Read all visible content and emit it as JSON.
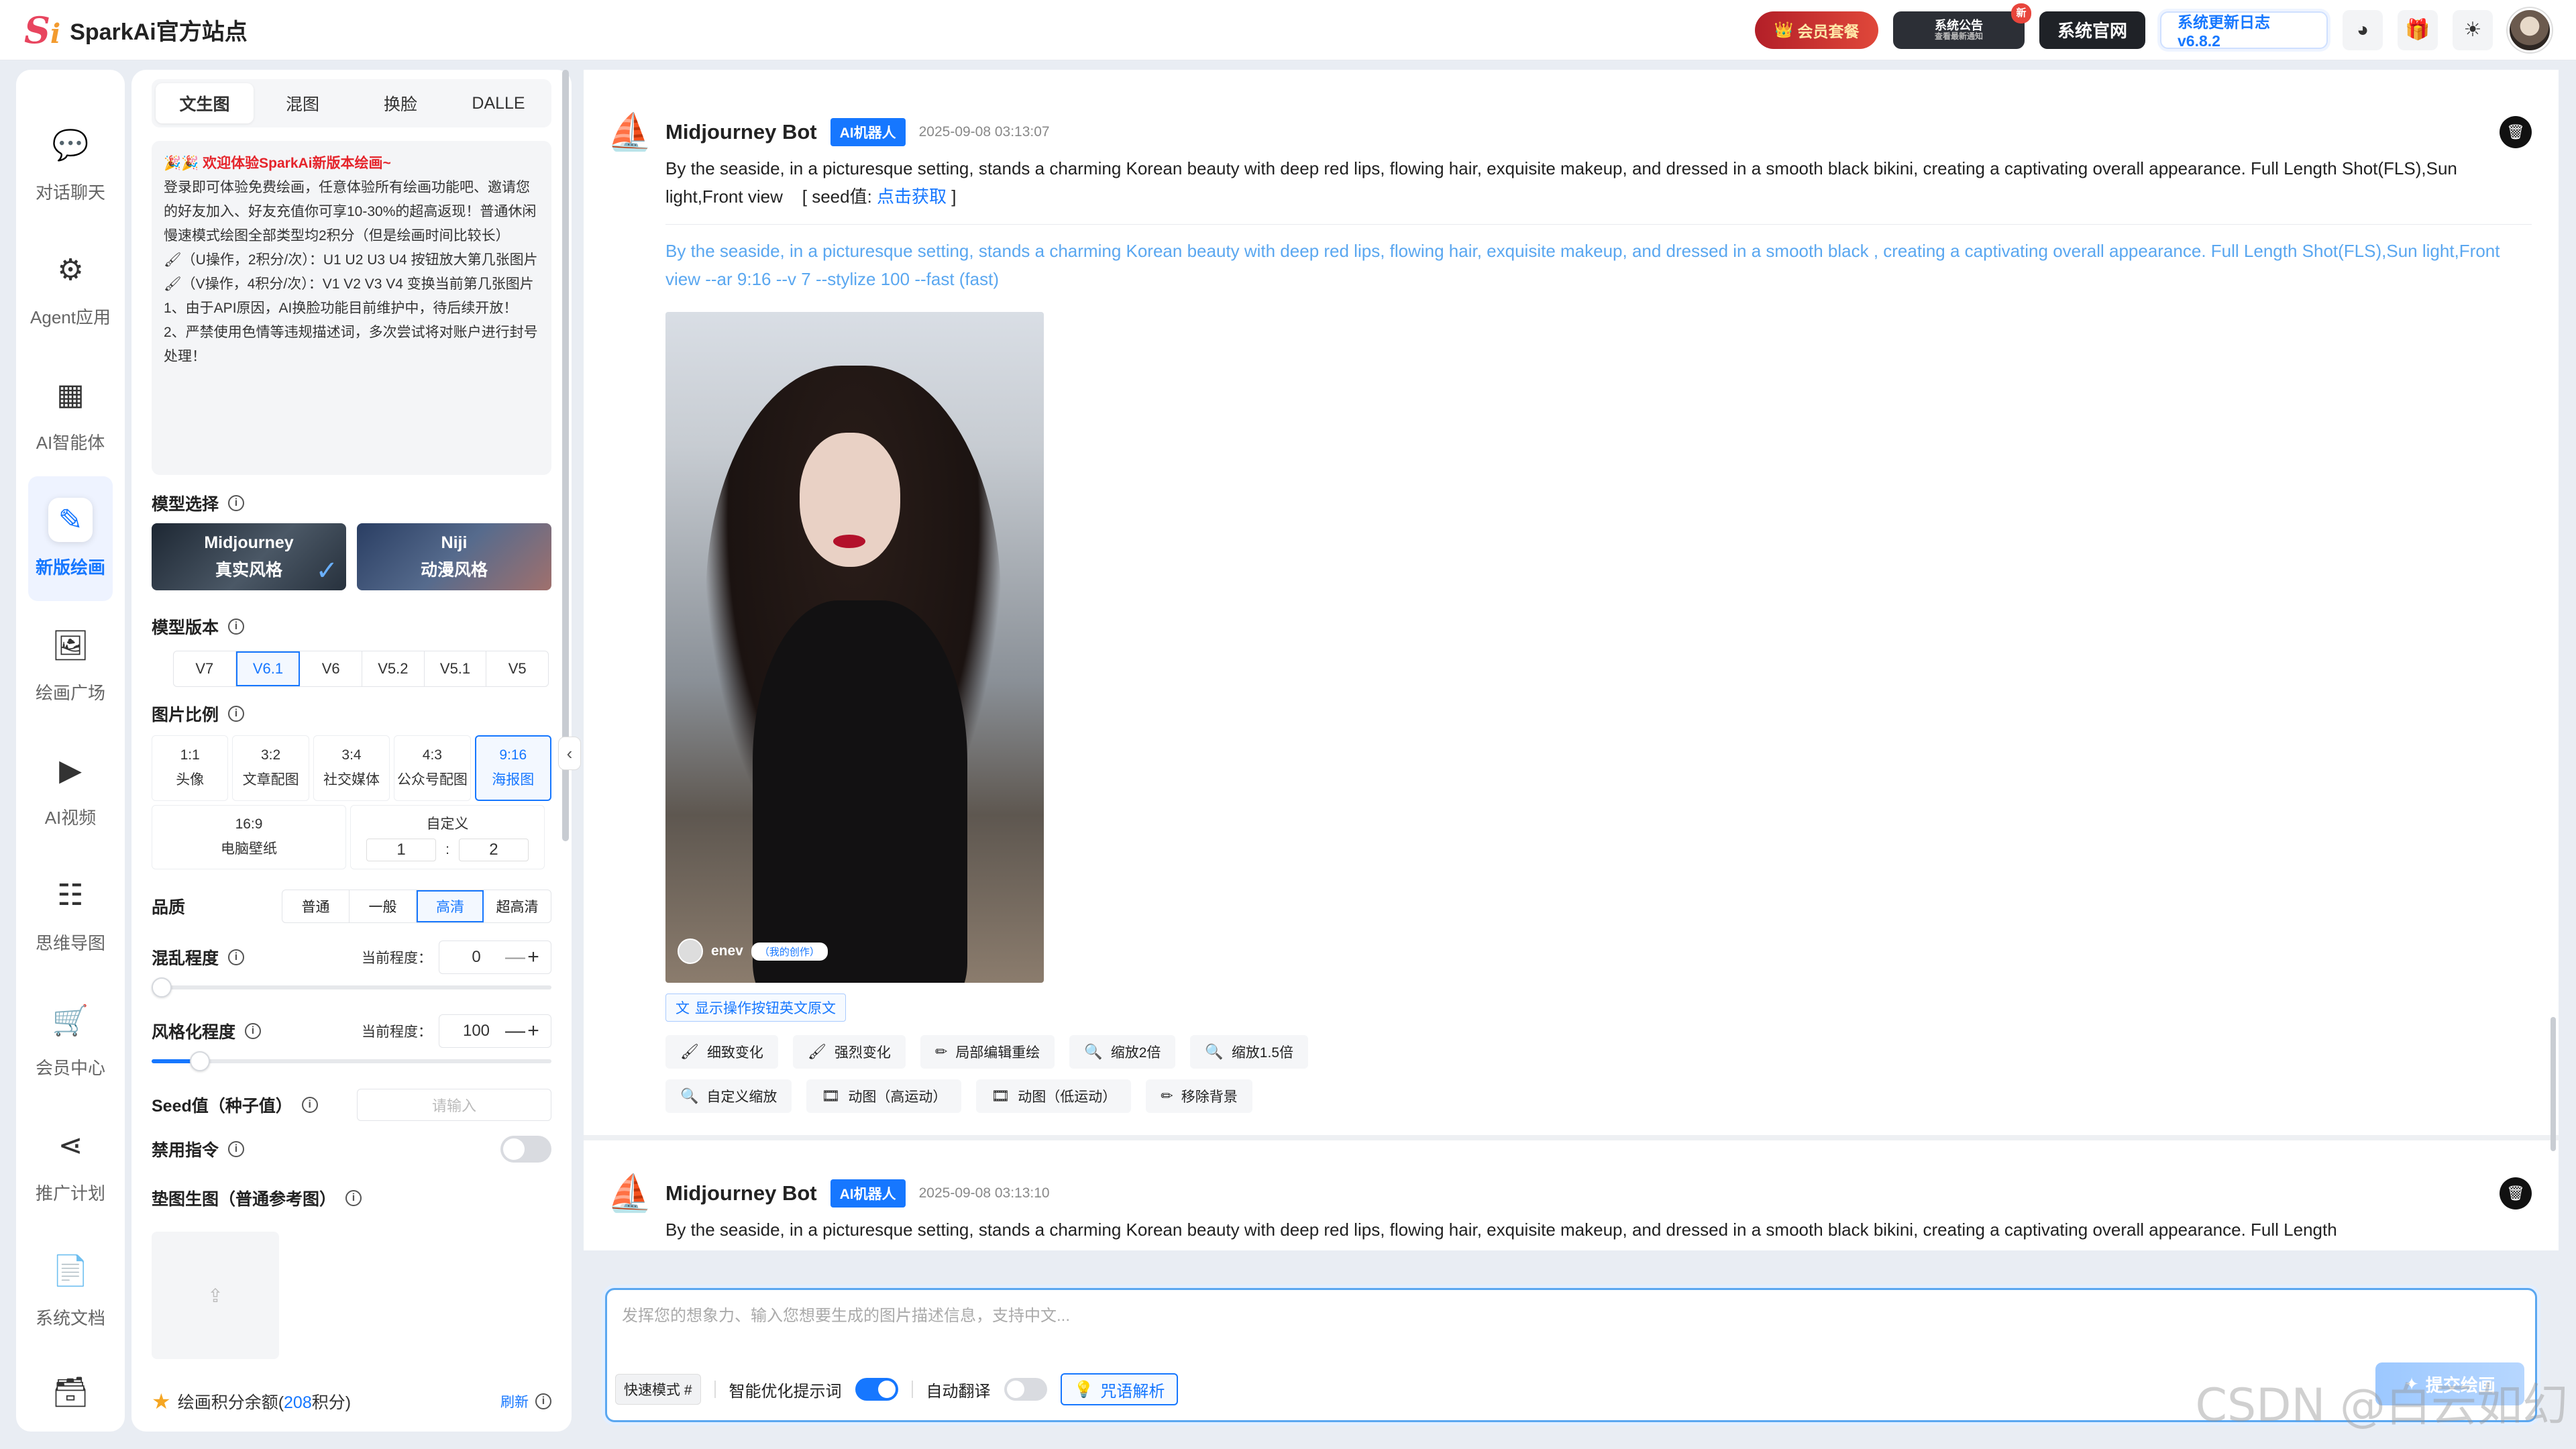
{
  "app": {
    "title": "SparkAi官方站点",
    "logo_text": "S"
  },
  "topbar": {
    "member_label": "会员套餐",
    "notice_label": "系统公告",
    "notice_sub": "查看最新通知",
    "notice_badge": "新",
    "site_label": "系统官网",
    "changelog_label": "系统更新日志 v6.8.2",
    "icons": [
      "wechat-icon",
      "gift-icon",
      "sun-icon",
      "avatar"
    ]
  },
  "sidebar": {
    "items": [
      {
        "label": "对话聊天",
        "icon": "chat-icon"
      },
      {
        "label": "Agent应用",
        "icon": "agent-icon"
      },
      {
        "label": "AI智能体",
        "icon": "grid-icon"
      },
      {
        "label": "新版绘画",
        "icon": "paint-icon",
        "active": true
      },
      {
        "label": "绘画广场",
        "icon": "gallery-icon"
      },
      {
        "label": "AI视频",
        "icon": "video-icon"
      },
      {
        "label": "思维导图",
        "icon": "mindmap-icon"
      },
      {
        "label": "会员中心",
        "icon": "cart-icon"
      },
      {
        "label": "推广计划",
        "icon": "share-icon"
      },
      {
        "label": "系统文档",
        "icon": "doc-icon"
      },
      {
        "label": "",
        "icon": "archive-icon"
      }
    ]
  },
  "panel": {
    "tabs": [
      "文生图",
      "混图",
      "换脸",
      "DALLE"
    ],
    "active_tab": "文生图",
    "notice": {
      "title": "欢迎体验SparkAi新版本绘画~",
      "body1": "登录即可体验免费绘画，任意体验所有绘画功能吧、邀请您的好友加入、好友充值你可享10-30%的超高返现！普通休闲慢速模式绘图全部类型均2积分（但是绘画时间比较长）",
      "body2": "（U操作，2积分/次）：U1 U2 U3 U4 按钮放大第几张图片",
      "body3": "（V操作，4积分/次）：V1 V2 V3 V4 变换当前第几张图片",
      "body4": "1、由于API原因，AI换脸功能目前维护中，待后续开放！",
      "body5": "2、严禁使用色情等违规描述词，多次尝试将对账户进行封号处理！"
    },
    "model_label": "模型选择",
    "models": [
      {
        "name": "Midjourney",
        "style": "真实风格",
        "selected": true
      },
      {
        "name": "Niji",
        "style": "动漫风格",
        "selected": false
      }
    ],
    "version_label": "模型版本",
    "versions": [
      "V7",
      "V6.1",
      "V6",
      "V5.2",
      "V5.1",
      "V5"
    ],
    "active_version": "V6.1",
    "ratio_label": "图片比例",
    "ratios": [
      {
        "ratio": "1:1",
        "name": "头像"
      },
      {
        "ratio": "3:2",
        "name": "文章配图"
      },
      {
        "ratio": "3:4",
        "name": "社交媒体"
      },
      {
        "ratio": "4:3",
        "name": "公众号配图"
      },
      {
        "ratio": "9:16",
        "name": "海报图",
        "active": true
      }
    ],
    "ratio_wide": {
      "ratio": "16:9",
      "name": "电脑壁纸"
    },
    "ratio_custom": {
      "name": "自定义",
      "w": "1",
      "sep": ":",
      "h": "2"
    },
    "quality_label": "品质",
    "qualities": [
      "普通",
      "一般",
      "高清",
      "超高清"
    ],
    "active_quality": "高清",
    "chaos_label": "混乱程度",
    "current_label": "当前程度：",
    "chaos_value": "0",
    "chaos_fraction": 0.0,
    "stylize_label": "风格化程度",
    "stylize_value": "100",
    "stylize_fraction": 0.1,
    "stepper_minus": "—",
    "stepper_plus": "+",
    "seed_label": "Seed值（种子值）",
    "seed_placeholder": "请输入",
    "ban_label": "禁用指令",
    "ref_label": "垫图生图（普通参考图）",
    "points_label": "绘画积分余额(",
    "points_value": "208",
    "points_suffix": "积分)",
    "refresh_label": "刷新"
  },
  "chat": {
    "messages": [
      {
        "bot": "Midjourney Bot",
        "badge": "AI机器人",
        "time": "2025-09-08 03:13:07",
        "prompt": "By the seaside, in a picturesque setting, stands a charming Korean beauty with deep red lips, flowing hair, exquisite makeup, and dressed in a smooth black bikini, creating a captivating overall appearance. Full Length Shot(FLS),Sun light,Front view",
        "seed_prefix": "[ seed值: ",
        "seed_link": "点击获取",
        "seed_suffix": " ]",
        "full_prompt": "By the seaside, in a picturesque setting, stands a charming Korean beauty with deep red lips, flowing hair, exquisite makeup, and dressed in a smooth black , creating a captivating overall appearance. Full Length Shot(FLS),Sun light,Front view --ar 9:16 --v 7 --stylize 100 --fast  (fast)",
        "image_user": "enev",
        "image_tag": "（我的创作）",
        "show_btn": "显示操作按钮英文原文",
        "actions": [
          "细致变化",
          "强烈变化",
          "局部编辑重绘",
          "缩放2倍",
          "缩放1.5倍",
          "自定义缩放",
          "动图（高运动）",
          "动图（低运动）",
          "移除背景"
        ]
      },
      {
        "bot": "Midjourney Bot",
        "badge": "AI机器人",
        "time": "2025-09-08 03:13:10",
        "prompt": "By the seaside, in a picturesque setting, stands a charming Korean beauty with deep red lips, flowing hair, exquisite makeup, and dressed in a smooth black bikini, creating a captivating overall appearance. Full Length"
      }
    ]
  },
  "composer": {
    "placeholder": "发挥您的想象力、输入您想要生成的图片描述信息，支持中文...",
    "fast_mode": "快速模式 #",
    "smart_label": "智能优化提示词",
    "smart_on": true,
    "translate_label": "自动翻译",
    "translate_on": false,
    "parse_label": "咒语解析",
    "submit_label": "提交绘画"
  },
  "watermark": "CSDN @白云如幻",
  "colors": {
    "accent": "#1677ff",
    "brand": "#e8455f"
  }
}
